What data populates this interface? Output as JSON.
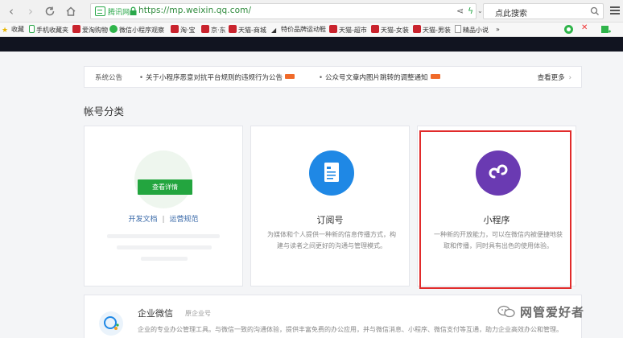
{
  "browser": {
    "trust_label": "腾讯网",
    "url": "https://mp.weixin.qq.com/",
    "search_placeholder": "点此搜索"
  },
  "bookmarks": [
    {
      "label": "收藏",
      "icon": "star-icon"
    },
    {
      "label": "手机收藏夹",
      "icon": "phone-icon"
    },
    {
      "label": "爱淘购物",
      "icon": "red-square-icon"
    },
    {
      "label": "微信小程序观察",
      "icon": "green-circle-icon"
    },
    {
      "label": "淘·宝",
      "icon": "red-square-icon"
    },
    {
      "label": "京·东",
      "icon": "red-square-icon"
    },
    {
      "label": "天猫-商城",
      "icon": "red-square-icon"
    },
    {
      "label": "特价品牌运动鞋",
      "icon": "shoe-icon"
    },
    {
      "label": "天猫-超市",
      "icon": "red-square-icon"
    },
    {
      "label": "天猫-女装",
      "icon": "red-square-icon"
    },
    {
      "label": "天猫-男装",
      "icon": "red-square-icon"
    },
    {
      "label": "精品小说",
      "icon": "page-icon"
    },
    {
      "label": "»",
      "icon": ""
    }
  ],
  "notice": {
    "title": "系统公告",
    "items": [
      "关于小程序恶意对抗平台规则的违规行为公告",
      "公众号文章内图片跳转的调整通知"
    ],
    "more_label": "查看更多"
  },
  "section_title": "帐号分类",
  "cards": {
    "service": {
      "button_label": "查看详情",
      "link_docs": "开发文档",
      "link_sep": "|",
      "link_ops": "运营规范"
    },
    "subscription": {
      "name": "订阅号",
      "description": "为媒体和个人提供一种新的信息传播方式，构建与读者之间更好的沟通与管理模式。",
      "icon_color": "#1f88e5"
    },
    "miniprogram": {
      "name": "小程序",
      "description": "一种新的开放能力，可以在微信内被便捷地获取和传播，同时具有出色的使用体验。",
      "icon_color": "#6a3ab2"
    }
  },
  "enterprise": {
    "title": "企业微信",
    "subtitle": "原企业号",
    "description": "企业的专业办公管理工具。与微信一致的沟通体验，提供丰富免费的办公应用，并与微信消息、小程序、微信支付等互通，助力企业高效办公和管理。"
  },
  "watermark": {
    "text": "网管爱好者"
  },
  "colors": {
    "highlight": "#e12b2b",
    "primary_green": "#23a53f",
    "header_dark": "#111420"
  }
}
